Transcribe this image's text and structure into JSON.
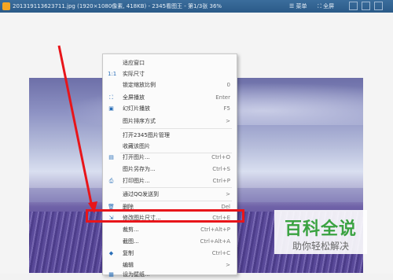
{
  "titlebar": {
    "title": "201319113623711.jpg (1920×1080像素, 418KB) - 2345看图王 - 第1/3张 36%",
    "menu_btn": "菜单",
    "fullscreen_btn": "全屏"
  },
  "menu": {
    "items": [
      {
        "label": "适应窗口",
        "shortcut": "",
        "icon": ""
      },
      {
        "label": "实际尺寸",
        "shortcut": "",
        "icon": "1:1"
      },
      {
        "label": "锁定缩放比例",
        "shortcut": "0",
        "icon": ""
      },
      {
        "label": "全屏播放",
        "shortcut": "Enter",
        "icon": "fullscreen-icon"
      },
      {
        "label": "幻灯片播放",
        "shortcut": "F5",
        "icon": "slideshow-icon"
      },
      {
        "label": "图片排序方式",
        "shortcut": ">",
        "icon": ""
      },
      {
        "label": "打开2345图片管理",
        "shortcut": "",
        "icon": ""
      },
      {
        "label": "收藏该图片",
        "shortcut": "",
        "icon": ""
      },
      {
        "label": "打开图片...",
        "shortcut": "Ctrl+O",
        "icon": "open-icon"
      },
      {
        "label": "图片另存为...",
        "shortcut": "Ctrl+S",
        "icon": ""
      },
      {
        "label": "打印图片...",
        "shortcut": "Ctrl+P",
        "icon": "print-icon"
      },
      {
        "label": "通过QQ发送到",
        "shortcut": ">",
        "icon": ""
      },
      {
        "label": "删除",
        "shortcut": "Del",
        "icon": "delete-icon"
      },
      {
        "label": "修改图片尺寸...",
        "shortcut": "Ctrl+E",
        "icon": "resize-icon"
      },
      {
        "label": "裁剪...",
        "shortcut": "Ctrl+Alt+P",
        "icon": ""
      },
      {
        "label": "截图...",
        "shortcut": "Ctrl+Alt+A",
        "icon": ""
      },
      {
        "label": "复制",
        "shortcut": "Ctrl+C",
        "icon": "copy-icon"
      },
      {
        "label": "编辑",
        "shortcut": ">",
        "icon": ""
      },
      {
        "label": "设为壁纸...",
        "shortcut": "",
        "icon": "wallpaper-icon"
      }
    ]
  },
  "watermark": {
    "title": "百科全说",
    "subtitle": "助你轻松解决"
  },
  "colors": {
    "highlight": "#e8151a",
    "watermark_green": "#3aa241",
    "titlebar": "#2b5a88"
  }
}
